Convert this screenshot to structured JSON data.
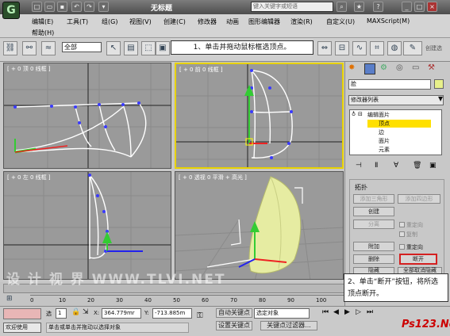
{
  "app": {
    "logo": "G",
    "title": "无标题",
    "search_placeholder": "键入关键字或短语"
  },
  "menu": [
    "编辑(E)",
    "工具(T)",
    "组(G)",
    "视图(V)",
    "创建(C)",
    "修改器",
    "动画",
    "图形编辑器",
    "渲染(R)",
    "自定义(U)",
    "MAXScript(M)",
    "帮助(H)"
  ],
  "toolbar": {
    "selection_filter": "全部",
    "create_selection_label": "创建选"
  },
  "viewports": [
    {
      "label": "[ + 0 顶 0 线框 ]"
    },
    {
      "label": "[ + 0 前 0 线框 ]"
    },
    {
      "label": "[ + 0 左 0 线框 ]"
    },
    {
      "label": "[ + 0 透视 0 平滑 + 高光 ]"
    }
  ],
  "command_panel": {
    "object_name": "脸",
    "modifier_list": "修改器列表",
    "stack": [
      "编辑面片",
      "顶点",
      "边",
      "面片",
      "元素"
    ],
    "rollout_title": "拓扑",
    "buttons": {
      "add_tri": "添加三角形",
      "add_quad": "添加四边形",
      "create": "创建",
      "detach": "分离",
      "attach": "附加",
      "delete": "删除",
      "break": "断开",
      "hide": "隐藏",
      "unhide_all": "全部取消隐藏"
    },
    "checkboxes": {
      "reorient": "重定向",
      "copy": "复制",
      "reorient2": "重定向"
    }
  },
  "callouts": {
    "step1": "1、单击并拖动鼠标框选顶点。",
    "step2": "2、单击“断开”按钮，将所选顶点断开。"
  },
  "timeline": {
    "ticks": [
      "0",
      "10",
      "20",
      "30",
      "40",
      "50",
      "60",
      "70",
      "80",
      "90",
      "100"
    ]
  },
  "status": {
    "selected_label": "选",
    "selected_count": "1",
    "x_label": "X:",
    "x_value": "364.779mr",
    "y_label": "Y:",
    "y_value": "-713.885m",
    "auto_key": "自动关键点",
    "set_key": "设置关键点",
    "selection_set": "选定对象",
    "key_filters": "关键点过滤器...",
    "welcome": "欢迎使用",
    "prompt": "单击或单击并拖动以选择对象"
  },
  "watermark": "设 计 视 界  WWW.TLVI.NET",
  "site_logo": "Ps123.Net",
  "colors": {
    "active_border": "#e8d200",
    "highlight_button": "#d42020",
    "stack_selected": "#ffe000"
  }
}
